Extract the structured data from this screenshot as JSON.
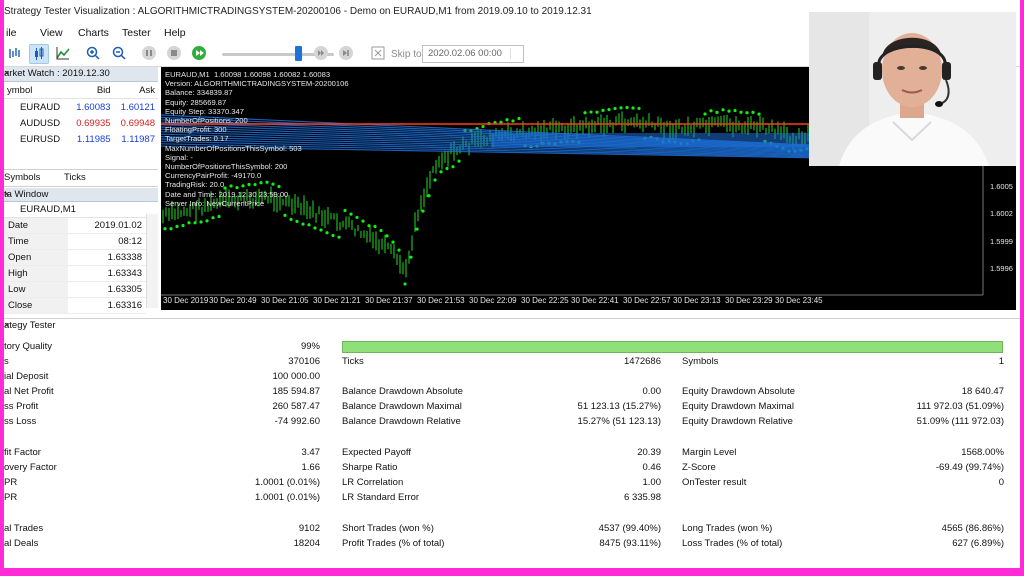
{
  "window": {
    "title": "Strategy Tester Visualization : ALGORITHMICTRADINGSYSTEM-20200106 - Demo on EURAUD,M1 from 2019.09.10 to 2019.12.31"
  },
  "menu": [
    "ile",
    "View",
    "Charts",
    "Tester",
    "Help"
  ],
  "toolbar": {
    "skip_label": "Skip to",
    "skip_date": "2020.02.06 00:00"
  },
  "market_watch": {
    "title": "arket Watch : 2019.12.30",
    "headers": [
      "ymbol",
      "Bid",
      "Ask"
    ],
    "rows": [
      {
        "symbol": "EURAUD",
        "bid": "1.60083",
        "ask": "1.60121"
      },
      {
        "symbol": "AUDUSD",
        "bid": "0.69935",
        "ask": "0.69948"
      },
      {
        "symbol": "EURUSD",
        "bid": "1.11985",
        "ask": "1.11987"
      }
    ]
  },
  "tabs": [
    "Symbols",
    "Ticks"
  ],
  "data_window": {
    "title": "ta Window",
    "symbol": "EURAUD,M1",
    "rows": [
      {
        "k": "Date",
        "v": "2019.01.02"
      },
      {
        "k": "Time",
        "v": "08:12"
      },
      {
        "k": "Open",
        "v": "1.63338"
      },
      {
        "k": "High",
        "v": "1.63343"
      },
      {
        "k": "Low",
        "v": "1.63305"
      },
      {
        "k": "Close",
        "v": "1.63316"
      }
    ]
  },
  "chart": {
    "info": "EURAUD,M1  1.60098 1.60098 1.60082 1.60083\nVersion: ALGORITHMICTRADINGSYSTEM-20200106\nBalance: 334839.87\nEquity: 285669.87\nEquity Step: 33370.347\nNumberOfPositions: 200\nFloatingProfit: 300\nTargetTrades: 0.17\nMaxNumberOfPositionsThisSymbol: 503\nSignal: -\nNumberOfPositionsThisSymbol: 200\nCurrencyPairProfit: -49170.0\nTradingRisk: 20.0\nDate and Time: 2019.12.30 23:59:00\nServer Info: NewCurrentPrice",
    "x_labels": [
      "30 Dec 2019",
      "30 Dec 20:49",
      "30 Dec 21:05",
      "30 Dec 21:21",
      "30 Dec 21:37",
      "30 Dec 21:53",
      "30 Dec 22:09",
      "30 Dec 22:25",
      "30 Dec 22:41",
      "30 Dec 22:57",
      "30 Dec 23:13",
      "30 Dec 23:29",
      "30 Dec 23:45"
    ],
    "y_labels": [
      "1.6005",
      "1.6002",
      "1.5999",
      "1.5996"
    ],
    "colors": {
      "bars": "#22dd22",
      "sar": "#11ee11",
      "red_line": "#ff3a1a",
      "blue_lines": "#1d6fd8"
    }
  },
  "tester": {
    "title": "ategy Tester",
    "quality_label": "tory Quality",
    "quality_value": "99%",
    "quality_level": 0.99,
    "rows": [
      {
        "a": "s",
        "av": "370106",
        "b": "Ticks",
        "bv": "1472686",
        "c": "Symbols",
        "cv": "1"
      },
      {
        "a": "ial Deposit",
        "av": "100 000.00",
        "b": "",
        "bv": "",
        "c": "",
        "cv": ""
      },
      {
        "a": "al Net Profit",
        "av": "185 594.87",
        "b": "Balance Drawdown Absolute",
        "bv": "0.00",
        "c": "Equity Drawdown Absolute",
        "cv": "18 640.47"
      },
      {
        "a": "ss Profit",
        "av": "260 587.47",
        "b": "Balance Drawdown Maximal",
        "bv": "51 123.13 (15.27%)",
        "c": "Equity Drawdown Maximal",
        "cv": "111 972.03 (51.09%)"
      },
      {
        "a": "ss Loss",
        "av": "-74 992.60",
        "b": "Balance Drawdown Relative",
        "bv": "15.27% (51 123.13)",
        "c": "Equity Drawdown Relative",
        "cv": "51.09% (111 972.03)"
      },
      {
        "a": "",
        "av": "",
        "b": "",
        "bv": "",
        "c": "",
        "cv": ""
      },
      {
        "a": "fit Factor",
        "av": "3.47",
        "b": "Expected Payoff",
        "bv": "20.39",
        "c": "Margin Level",
        "cv": "1568.00%"
      },
      {
        "a": "overy Factor",
        "av": "1.66",
        "b": "Sharpe Ratio",
        "bv": "0.46",
        "c": "Z-Score",
        "cv": "-69.49 (99.74%)"
      },
      {
        "a": "PR",
        "av": "1.0001 (0.01%)",
        "b": "LR Correlation",
        "bv": "1.00",
        "c": "OnTester result",
        "cv": "0"
      },
      {
        "a": "PR",
        "av": "1.0001 (0.01%)",
        "b": "LR Standard Error",
        "bv": "6 335.98",
        "c": "",
        "cv": ""
      },
      {
        "a": "",
        "av": "",
        "b": "",
        "bv": "",
        "c": "",
        "cv": ""
      },
      {
        "a": "al Trades",
        "av": "9102",
        "b": "Short Trades (won %)",
        "bv": "4537 (99.40%)",
        "c": "Long Trades (won %)",
        "cv": "4565 (86.86%)"
      },
      {
        "a": "al Deals",
        "av": "18204",
        "b": "Profit Trades (% of total)",
        "bv": "8475 (93.11%)",
        "c": "Loss Trades (% of total)",
        "cv": "627 (6.89%)"
      }
    ]
  }
}
